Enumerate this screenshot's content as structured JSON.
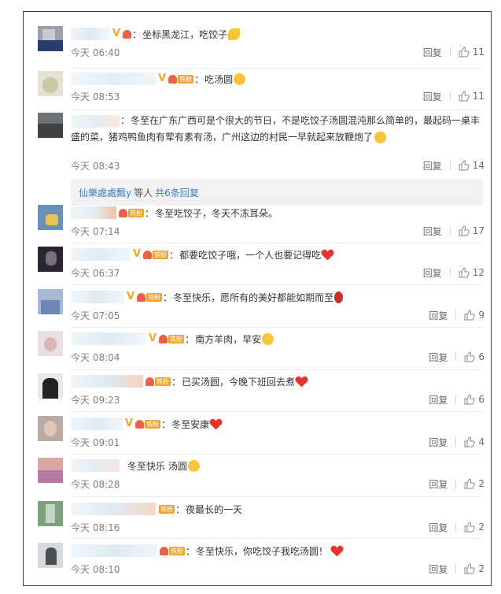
{
  "reply_label": "回复",
  "thread_1": {
    "user": "仙樂處處飄y",
    "suffix": "等人",
    "more": "共6条回复"
  },
  "comments": [
    {
      "text": "坐标黑龙江，吃饺子",
      "time": "今天 06:40",
      "likes": "11",
      "emoji": "lemon"
    },
    {
      "text": "吃汤圆",
      "time": "今天 08:53",
      "likes": "11",
      "emoji": "tears"
    },
    {
      "text": "冬至在广东广西可是个很大的节日，不是吃饺子汤圆混沌那么简单的，最起码一桌丰盛的菜，猪鸡鸭鱼肉有荤有素有汤，广州这边的村民一早就起来放鞭炮了",
      "time": "今天 08:43",
      "likes": "14",
      "emoji": "laugh"
    },
    {
      "text": "冬至吃饺子，冬天不冻耳朵。",
      "time": "今天 07:14",
      "likes": "17"
    },
    {
      "text": "都要吃饺子哦，一个人也要记得吃",
      "time": "今天 06:37",
      "likes": "12",
      "emoji": "heart"
    },
    {
      "text": "冬至快乐，愿所有的美好都能如期而至",
      "time": "今天 07:05",
      "likes": "9",
      "emoji": "rose"
    },
    {
      "text": "南方羊肉，早安",
      "time": "今天 08:04",
      "likes": "6",
      "emoji": "kiss"
    },
    {
      "text": "已买汤圆，今晚下班回去煮",
      "time": "今天 09:23",
      "likes": "6",
      "emoji": "heart"
    },
    {
      "text": "冬至安康",
      "time": "今天 09:01",
      "likes": "4",
      "emoji": "heart"
    },
    {
      "text": "冬至快乐 汤圆",
      "time": "今天 08:28",
      "likes": "2",
      "emoji": "grin"
    },
    {
      "text": "夜最长的一天",
      "time": "今天 08:16",
      "likes": "2"
    },
    {
      "text": "冬至快乐，你吃饺子我吃汤圆！",
      "time": "今天 08:10",
      "likes": "2",
      "emoji": "heart"
    }
  ],
  "badge_text": {
    "v": "V",
    "tier": "铁粉",
    "colon": "："
  }
}
